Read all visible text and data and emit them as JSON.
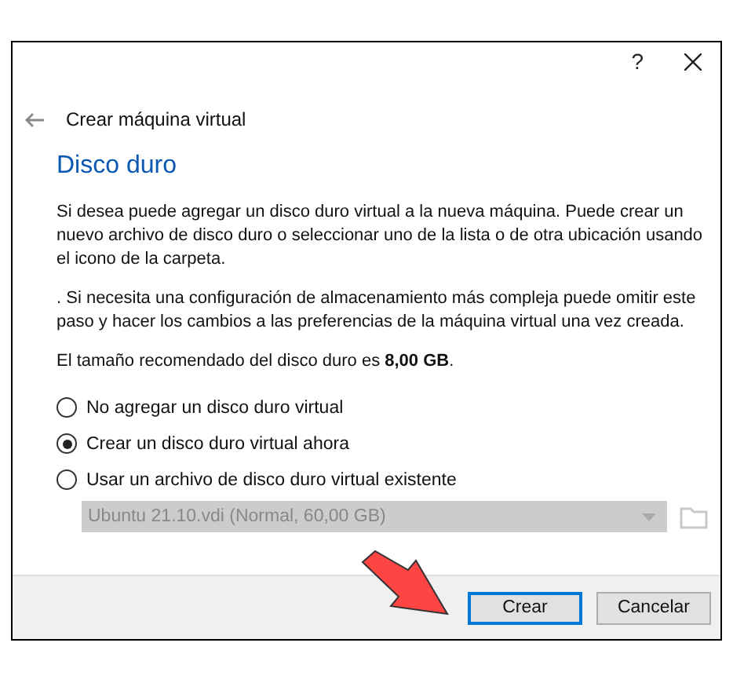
{
  "window": {
    "help": "?"
  },
  "wizard_title": "Crear máquina virtual",
  "heading": "Disco duro",
  "paragraphs": [
    "Si desea puede agregar un disco duro virtual a la nueva máquina. Puede crear un nuevo archivo de disco duro o seleccionar uno de la lista o de otra ubicación usando el icono de la carpeta.",
    ". Si necesita una configuración de almacenamiento más compleja puede omitir este paso y hacer los cambios a las preferencias de la máquina virtual una vez creada.",
    "El tamaño recomendado del disco duro es **8,00 GB**."
  ],
  "options": [
    {
      "label": "No agregar un disco duro virtual",
      "selected": false
    },
    {
      "label": "Crear un disco duro virtual ahora",
      "selected": true
    },
    {
      "label": "Usar un archivo de disco duro virtual existente",
      "selected": false
    }
  ],
  "disk_select": {
    "value": "Ubuntu 21.10.vdi (Normal, 60,00 GB)",
    "disabled": true
  },
  "buttons": [
    {
      "label": "Crear",
      "default": true
    },
    {
      "label": "Cancelar",
      "default": false
    }
  ]
}
